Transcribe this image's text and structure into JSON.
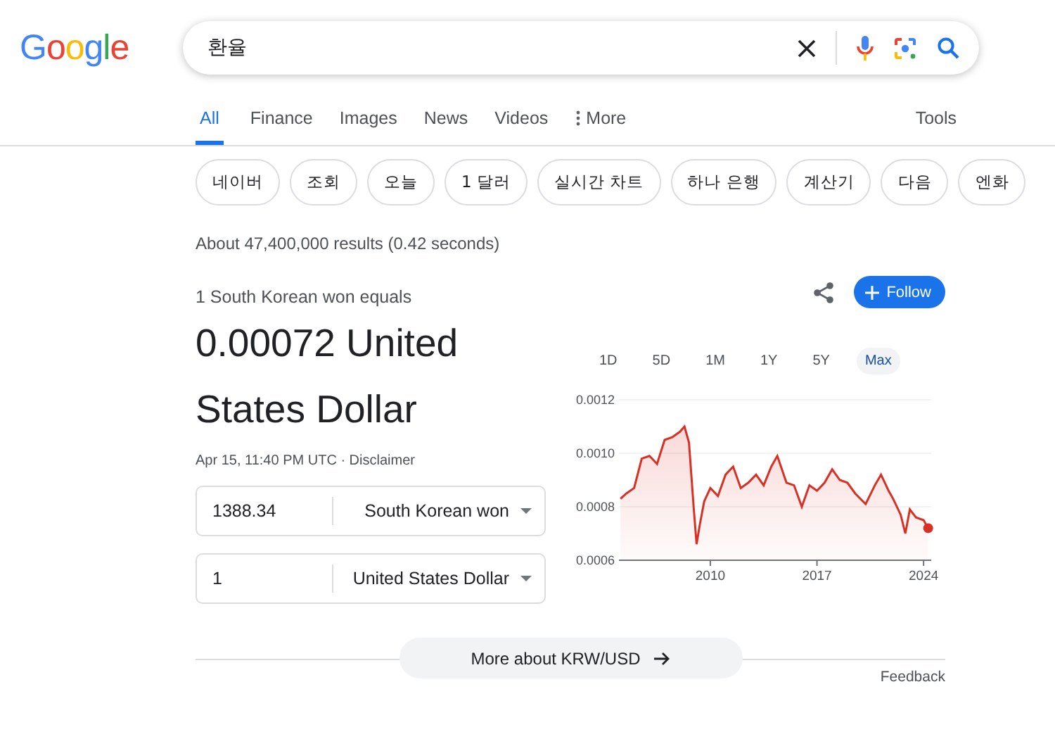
{
  "logo": "Google",
  "search": {
    "value": "환율"
  },
  "tabs": [
    {
      "label": "All",
      "selected": true
    },
    {
      "label": "Finance",
      "selected": false
    },
    {
      "label": "Images",
      "selected": false
    },
    {
      "label": "News",
      "selected": false
    },
    {
      "label": "Videos",
      "selected": false
    },
    {
      "label": "More",
      "selected": false,
      "kind": "menu"
    }
  ],
  "tools": "Tools",
  "chips": [
    "네이버",
    "조회",
    "오늘",
    "1 달러",
    "실시간 차트",
    "하나 은행",
    "계산기",
    "다음",
    "엔화"
  ],
  "results_info": "About 47,400,000 results (0.42 seconds)",
  "converter": {
    "caption": "1 South Korean won equals",
    "result": "0.00072 United States Dollar",
    "timestamp": "Apr 15, 11:40 PM UTC · ",
    "disclaimer": "Disclaimer",
    "rows": [
      {
        "amount": "1388.34",
        "currency": "South Korean won"
      },
      {
        "amount": "1",
        "currency": "United States Dollar"
      }
    ]
  },
  "follow_button": "Follow",
  "ranges": [
    {
      "label": "1D",
      "selected": false
    },
    {
      "label": "5D",
      "selected": false
    },
    {
      "label": "1M",
      "selected": false
    },
    {
      "label": "1Y",
      "selected": false
    },
    {
      "label": "5Y",
      "selected": false
    },
    {
      "label": "Max",
      "selected": true
    }
  ],
  "chart_data": {
    "type": "area",
    "xlim": [
      2004,
      2024.5
    ],
    "ylim": [
      0.0006,
      0.0012
    ],
    "xticks": [
      2010,
      2017,
      2024
    ],
    "yticks": [
      {
        "value": 0.0006,
        "label": "0.0006"
      },
      {
        "value": 0.0008,
        "label": "0.0008"
      },
      {
        "value": 0.001,
        "label": "0.0010"
      },
      {
        "value": 0.0012,
        "label": "0.0012"
      }
    ],
    "x": [
      2004.1,
      2004.5,
      2005,
      2005.5,
      2006,
      2006.5,
      2007,
      2007.5,
      2008,
      2008.3,
      2008.6,
      2008.9,
      2009.1,
      2009.3,
      2009.6,
      2010,
      2010.5,
      2011,
      2011.5,
      2012,
      2012.5,
      2013,
      2013.5,
      2014,
      2014.4,
      2015,
      2015.5,
      2016,
      2016.5,
      2017,
      2017.5,
      2018,
      2018.5,
      2019,
      2019.5,
      2020.2,
      2020.8,
      2021.2,
      2021.7,
      2022,
      2022.5,
      2022.8,
      2023.1,
      2023.5,
      2024,
      2024.3
    ],
    "series": [
      {
        "color": "#d93025",
        "values": [
          0.00083,
          0.00085,
          0.00087,
          0.00098,
          0.00099,
          0.00096,
          0.00105,
          0.00106,
          0.00108,
          0.0011,
          0.00104,
          0.0008,
          0.00066,
          0.00073,
          0.00082,
          0.00087,
          0.00084,
          0.00092,
          0.00095,
          0.00087,
          0.00089,
          0.00092,
          0.00088,
          0.00095,
          0.00099,
          0.00089,
          0.00088,
          0.0008,
          0.00088,
          0.00086,
          0.00089,
          0.00094,
          0.0009,
          0.00089,
          0.00085,
          0.00081,
          0.00088,
          0.00092,
          0.00086,
          0.00083,
          0.00077,
          0.0007,
          0.00079,
          0.00076,
          0.00075,
          0.00072
        ]
      }
    ]
  },
  "more_button": "More about KRW/USD",
  "feedback": "Feedback"
}
